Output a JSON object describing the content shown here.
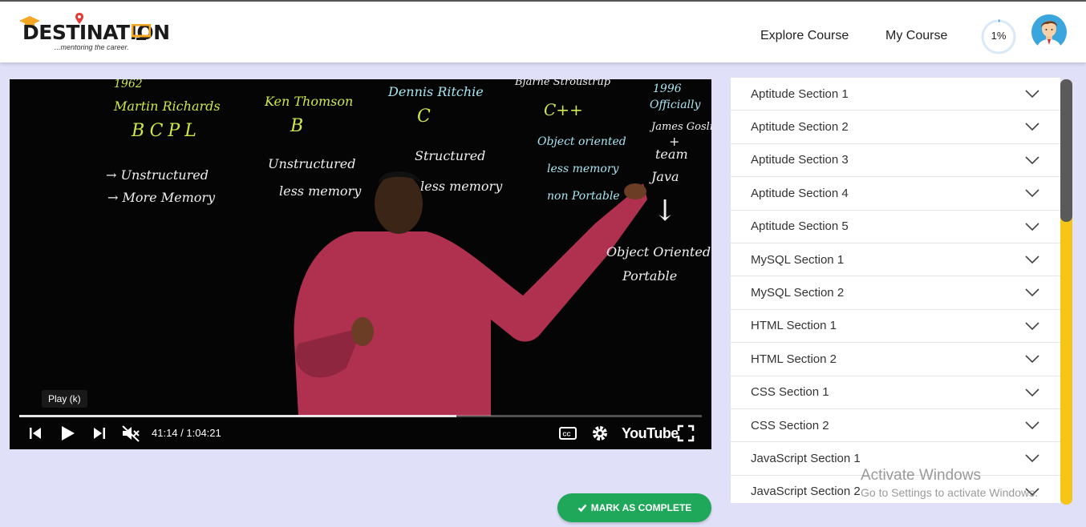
{
  "header": {
    "logo_text": "DESTINATION",
    "logo_tagline": "...mentoring the career.",
    "nav": [
      {
        "label": "Explore Course"
      },
      {
        "label": "My Course"
      }
    ],
    "progress_label": "1%",
    "progress_value": 0.01
  },
  "video": {
    "board": {
      "year_1962": "1962",
      "martin": "Martin Richards",
      "bcpl": "BCPL",
      "unstructured1": "→ Unstructured",
      "more_memory": "→ More Memory",
      "ken": "Ken Thomson",
      "b": "B",
      "unstructured2": "Unstructured",
      "less_memory1": "less memory",
      "dennis": "Dennis Ritchie",
      "c": "C",
      "structured": "Structured",
      "less_memory2": "less memory",
      "bjarne": "Bjarne Stroustrup",
      "cpp": "C++",
      "oo": "Object oriented",
      "less_memory3": "less memory",
      "non_portable": "non Portable",
      "year_1996": "1996",
      "officially": "Officially",
      "james": "James Gosling",
      "plus": "+",
      "team": "team",
      "java": "Java",
      "arrow": "↓",
      "oo2": "Object Oriented",
      "portable": "Portable"
    },
    "tooltip": "Play (k)",
    "time": "41:14 / 1:04:21",
    "progress_fraction": 0.64,
    "youtube_label": "YouTube",
    "icons": [
      "previous-icon",
      "play-icon",
      "next-icon",
      "mute-icon",
      "captions-icon",
      "settings-icon",
      "fullscreen-icon"
    ]
  },
  "mark_complete": {
    "label": "MARK AS COMPLETE",
    "icon": "check-icon"
  },
  "sections": [
    {
      "label": "Aptitude Section 1"
    },
    {
      "label": "Aptitude Section 2"
    },
    {
      "label": "Aptitude Section 3"
    },
    {
      "label": "Aptitude Section 4"
    },
    {
      "label": "Aptitude Section 5"
    },
    {
      "label": "MySQL Section 1"
    },
    {
      "label": "MySQL Section 2"
    },
    {
      "label": "HTML Section 1"
    },
    {
      "label": "HTML Section 2"
    },
    {
      "label": "CSS Section 1"
    },
    {
      "label": "CSS Section 2"
    },
    {
      "label": "JavaScript Section 1"
    },
    {
      "label": "JavaScript Section 2"
    }
  ],
  "watermark": {
    "title": "Activate Windows",
    "subtitle": "Go to Settings to activate Windows."
  },
  "colors": {
    "accent": "#1fa85a",
    "scrollbar": "#f5c518",
    "page_bg": "#e0e0f8"
  }
}
